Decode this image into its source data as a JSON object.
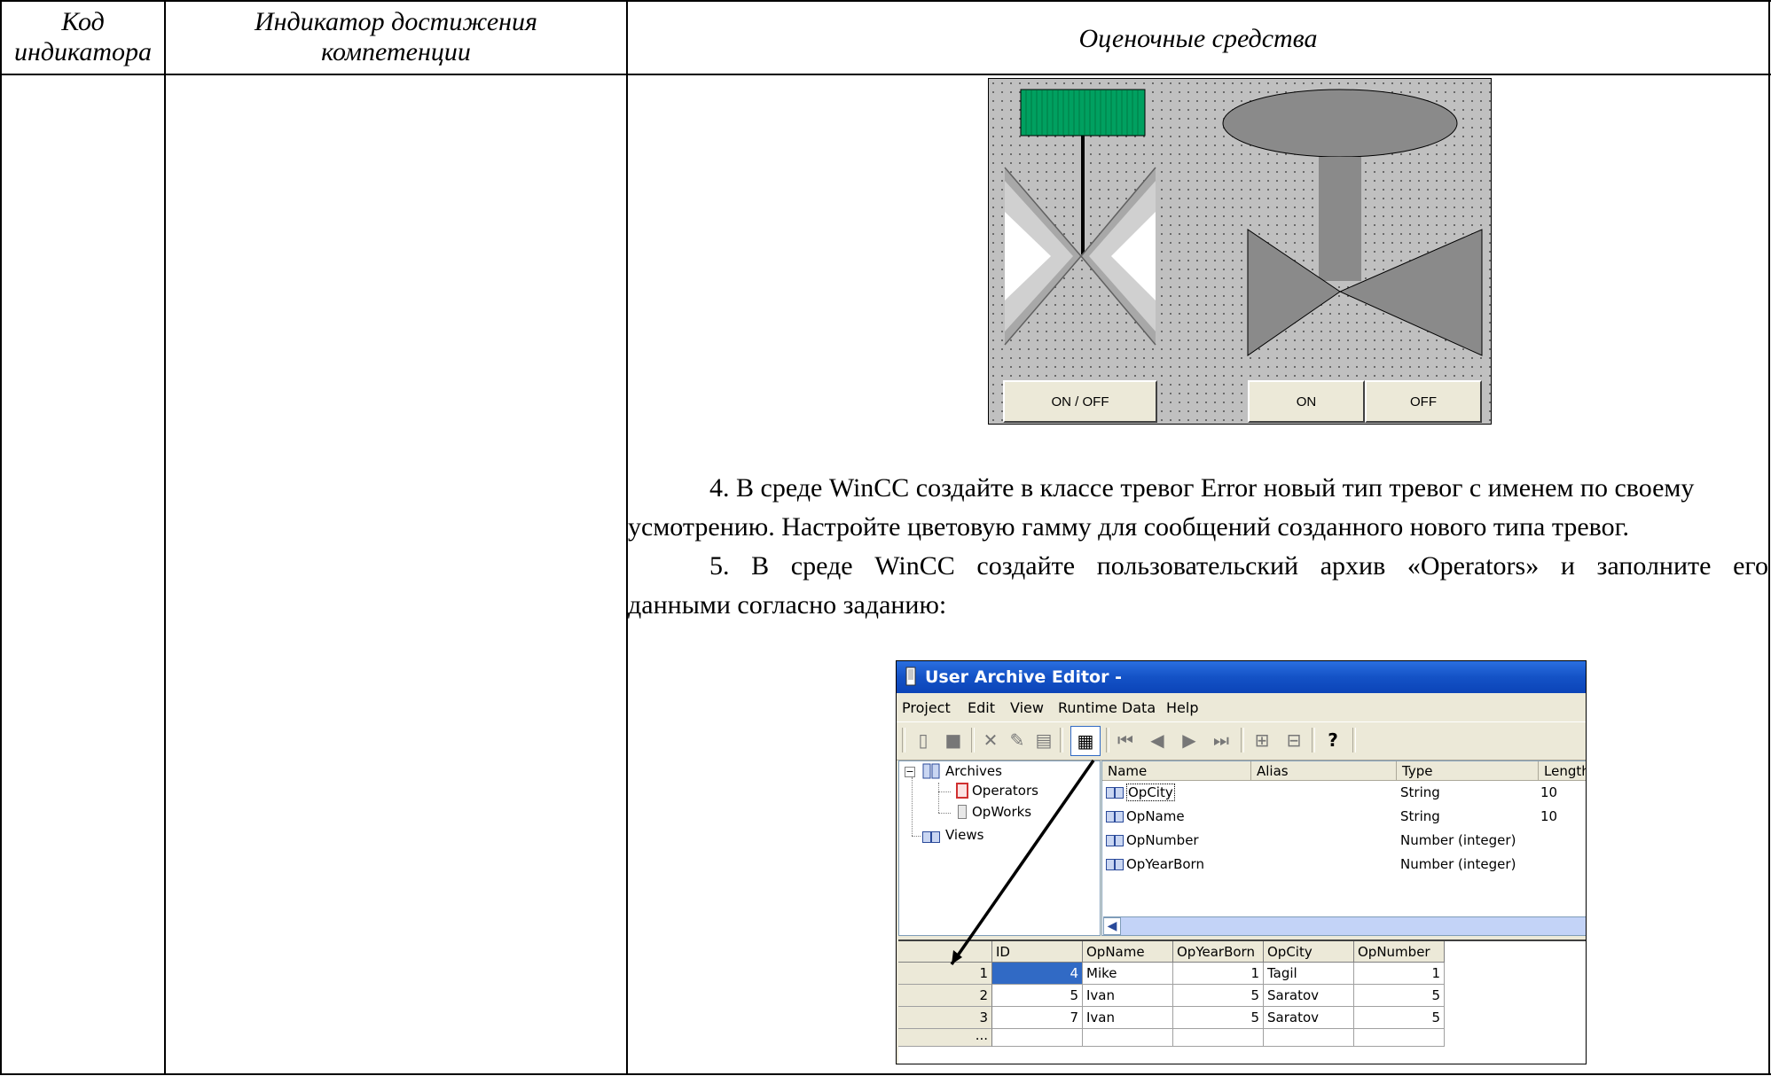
{
  "table_header": {
    "col1_line1": "Код",
    "col1_line2": "индикатора",
    "col2_line1": "Индикатор достижения",
    "col2_line2": "компетенции",
    "col3": "Оценочные средства"
  },
  "valve_screen": {
    "button_on_off": "ON / OFF",
    "button_on": "ON",
    "button_off": "OFF"
  },
  "tasks": [
    {
      "line1": "4. В среде WinCC создайте в классе тревог Error новый тип тревог с именем по своему",
      "line2": "усмотрению. Настройте цветовую гамму для сообщений созданного нового типа тревог."
    },
    {
      "line1": "5. В среде WinCC создайте пользовательский архив «Operators» и заполните его",
      "line2": "данными согласно заданию:"
    }
  ],
  "editor": {
    "title": "User Archive Editor -",
    "menu": [
      "Project",
      "Edit",
      "View",
      "Runtime Data",
      "Help"
    ],
    "tree": {
      "root": "Archives",
      "children": [
        "Operators",
        "OpWorks"
      ],
      "views": "Views"
    },
    "field_columns": [
      "Name",
      "Alias",
      "Type",
      "Length"
    ],
    "fields": [
      {
        "name": "OpCity",
        "alias": "",
        "type": "String",
        "length": "10"
      },
      {
        "name": "OpName",
        "alias": "",
        "type": "String",
        "length": "10"
      },
      {
        "name": "OpNumber",
        "alias": "",
        "type": "Number (integer)",
        "length": ""
      },
      {
        "name": "OpYearBorn",
        "alias": "",
        "type": "Number (integer)",
        "length": ""
      }
    ],
    "grid_columns": [
      "ID",
      "OpName",
      "OpYearBorn",
      "OpCity",
      "OpNumber"
    ],
    "grid_rows": [
      {
        "row": "1",
        "id": "4",
        "opname": "Mike",
        "opyearborn": "1",
        "opcity": "Tagil",
        "opnumber": "1"
      },
      {
        "row": "2",
        "id": "5",
        "opname": "Ivan",
        "opyearborn": "5",
        "opcity": "Saratov",
        "opnumber": "5"
      },
      {
        "row": "3",
        "id": "7",
        "opname": "Ivan",
        "opyearborn": "5",
        "opcity": "Saratov",
        "opnumber": "5"
      }
    ],
    "new_row_marker": "..."
  },
  "colors": {
    "valve_green": "#00a060",
    "valve_gray": "#8a8a8a",
    "title_blue": "#1452c6",
    "selection_blue": "#316ac5"
  }
}
